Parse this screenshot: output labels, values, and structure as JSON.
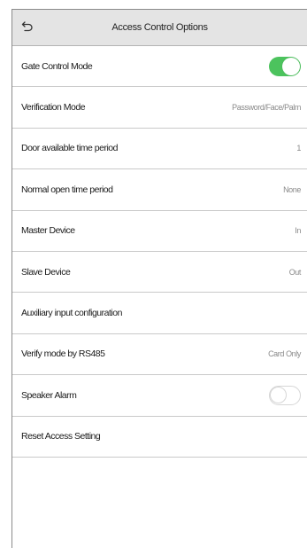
{
  "header": {
    "title": "Access Control Options",
    "back_icon": "back-arrow-icon"
  },
  "rows": [
    {
      "label": "Gate Control Mode",
      "control": "toggle",
      "state": "on"
    },
    {
      "label": "Verification Mode",
      "value": "Password/Face/Palm"
    },
    {
      "label": "Door available time period",
      "value": "1"
    },
    {
      "label": "Normal open time period",
      "value": "None"
    },
    {
      "label": "Master Device",
      "value": "In"
    },
    {
      "label": "Slave Device",
      "value": "Out"
    },
    {
      "label": "Auxiliary input configuration"
    },
    {
      "label": "Verify mode by RS485",
      "value": "Card Only"
    },
    {
      "label": "Speaker Alarm",
      "control": "toggle",
      "state": "off"
    },
    {
      "label": "Reset Access Setting"
    }
  ],
  "colors": {
    "header_bg": "#e4e4e4",
    "toggle_on": "#4cc35d",
    "value_text": "#8a8a8a"
  }
}
